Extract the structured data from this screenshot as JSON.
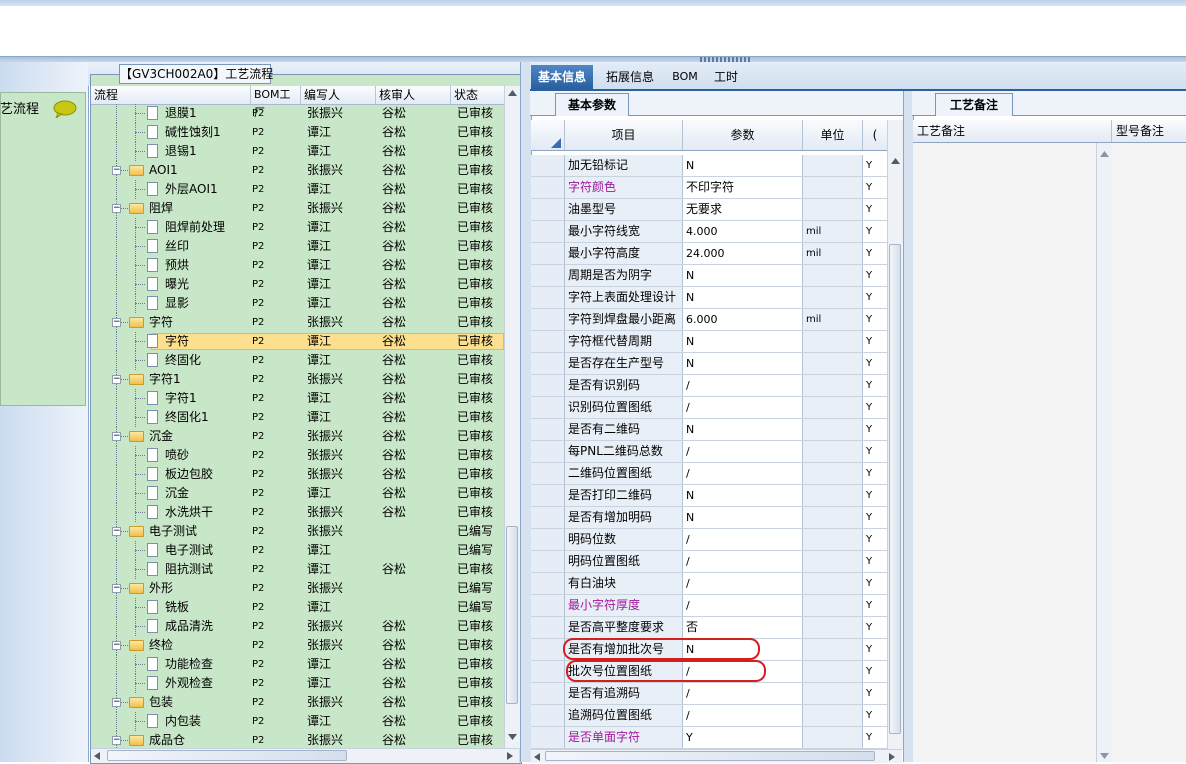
{
  "tree_panel": {
    "tab_title": "【GV3CH002A0】工艺流程",
    "left_label": "艺流程",
    "columns": [
      "流程",
      "BOM工厂",
      "编写人",
      "核审人",
      "状态"
    ],
    "rows": [
      {
        "level": 2,
        "type": "file",
        "name": "退膜1",
        "bom": "P2",
        "writer": "张振兴",
        "reviewer": "谷松",
        "status": "已审核"
      },
      {
        "level": 2,
        "type": "file",
        "name": "碱性蚀刻1",
        "bom": "P2",
        "writer": "谭江",
        "reviewer": "谷松",
        "status": "已审核"
      },
      {
        "level": 2,
        "type": "file",
        "name": "退锡1",
        "bom": "P2",
        "writer": "谭江",
        "reviewer": "谷松",
        "status": "已审核"
      },
      {
        "level": 1,
        "type": "folder",
        "name": "AOI1",
        "bom": "P2",
        "writer": "张振兴",
        "reviewer": "谷松",
        "status": "已审核"
      },
      {
        "level": 2,
        "type": "file",
        "name": "外层AOI1",
        "bom": "P2",
        "writer": "谭江",
        "reviewer": "谷松",
        "status": "已审核"
      },
      {
        "level": 1,
        "type": "folder",
        "name": "阻焊",
        "bom": "P2",
        "writer": "张振兴",
        "reviewer": "谷松",
        "status": "已审核"
      },
      {
        "level": 2,
        "type": "file",
        "name": "阻焊前处理",
        "bom": "P2",
        "writer": "谭江",
        "reviewer": "谷松",
        "status": "已审核"
      },
      {
        "level": 2,
        "type": "file",
        "name": "丝印",
        "bom": "P2",
        "writer": "谭江",
        "reviewer": "谷松",
        "status": "已审核"
      },
      {
        "level": 2,
        "type": "file",
        "name": "预烘",
        "bom": "P2",
        "writer": "谭江",
        "reviewer": "谷松",
        "status": "已审核"
      },
      {
        "level": 2,
        "type": "file",
        "name": "曝光",
        "bom": "P2",
        "writer": "谭江",
        "reviewer": "谷松",
        "status": "已审核"
      },
      {
        "level": 2,
        "type": "file",
        "name": "显影",
        "bom": "P2",
        "writer": "谭江",
        "reviewer": "谷松",
        "status": "已审核"
      },
      {
        "level": 1,
        "type": "folder",
        "name": "字符",
        "bom": "P2",
        "writer": "张振兴",
        "reviewer": "谷松",
        "status": "已审核"
      },
      {
        "level": 2,
        "type": "file",
        "name": "字符",
        "bom": "P2",
        "writer": "谭江",
        "reviewer": "谷松",
        "status": "已审核",
        "selected": true
      },
      {
        "level": 2,
        "type": "file",
        "name": "终固化",
        "bom": "P2",
        "writer": "谭江",
        "reviewer": "谷松",
        "status": "已审核"
      },
      {
        "level": 1,
        "type": "folder",
        "name": "字符1",
        "bom": "P2",
        "writer": "张振兴",
        "reviewer": "谷松",
        "status": "已审核"
      },
      {
        "level": 2,
        "type": "file",
        "name": "字符1",
        "bom": "P2",
        "writer": "谭江",
        "reviewer": "谷松",
        "status": "已审核"
      },
      {
        "level": 2,
        "type": "file",
        "name": "终固化1",
        "bom": "P2",
        "writer": "谭江",
        "reviewer": "谷松",
        "status": "已审核"
      },
      {
        "level": 1,
        "type": "folder",
        "name": "沉金",
        "bom": "P2",
        "writer": "张振兴",
        "reviewer": "谷松",
        "status": "已审核"
      },
      {
        "level": 2,
        "type": "file",
        "name": "喷砂",
        "bom": "P2",
        "writer": "张振兴",
        "reviewer": "谷松",
        "status": "已审核"
      },
      {
        "level": 2,
        "type": "file",
        "name": "板边包胶",
        "bom": "P2",
        "writer": "张振兴",
        "reviewer": "谷松",
        "status": "已审核"
      },
      {
        "level": 2,
        "type": "file",
        "name": "沉金",
        "bom": "P2",
        "writer": "谭江",
        "reviewer": "谷松",
        "status": "已审核"
      },
      {
        "level": 2,
        "type": "file",
        "name": "水洗烘干",
        "bom": "P2",
        "writer": "张振兴",
        "reviewer": "谷松",
        "status": "已审核"
      },
      {
        "level": 1,
        "type": "folder",
        "name": "电子测试",
        "bom": "P2",
        "writer": "张振兴",
        "reviewer": "",
        "status": "已编写"
      },
      {
        "level": 2,
        "type": "file",
        "name": "电子测试",
        "bom": "P2",
        "writer": "谭江",
        "reviewer": "",
        "status": "已编写"
      },
      {
        "level": 2,
        "type": "file",
        "name": "阻抗测试",
        "bom": "P2",
        "writer": "谭江",
        "reviewer": "谷松",
        "status": "已审核"
      },
      {
        "level": 1,
        "type": "folder",
        "name": "外形",
        "bom": "P2",
        "writer": "张振兴",
        "reviewer": "",
        "status": "已编写"
      },
      {
        "level": 2,
        "type": "file",
        "name": "铣板",
        "bom": "P2",
        "writer": "谭江",
        "reviewer": "",
        "status": "已编写"
      },
      {
        "level": 2,
        "type": "file",
        "name": "成品清洗",
        "bom": "P2",
        "writer": "张振兴",
        "reviewer": "谷松",
        "status": "已审核"
      },
      {
        "level": 1,
        "type": "folder",
        "name": "终检",
        "bom": "P2",
        "writer": "张振兴",
        "reviewer": "谷松",
        "status": "已审核"
      },
      {
        "level": 2,
        "type": "file",
        "name": "功能检查",
        "bom": "P2",
        "writer": "谭江",
        "reviewer": "谷松",
        "status": "已审核"
      },
      {
        "level": 2,
        "type": "file",
        "name": "外观检查",
        "bom": "P2",
        "writer": "谭江",
        "reviewer": "谷松",
        "status": "已审核"
      },
      {
        "level": 1,
        "type": "folder",
        "name": "包装",
        "bom": "P2",
        "writer": "张振兴",
        "reviewer": "谷松",
        "status": "已审核"
      },
      {
        "level": 2,
        "type": "file",
        "name": "内包装",
        "bom": "P2",
        "writer": "谭江",
        "reviewer": "谷松",
        "status": "已审核"
      },
      {
        "level": 1,
        "type": "folder",
        "name": "成品仓",
        "bom": "P2",
        "writer": "张振兴",
        "reviewer": "谷松",
        "status": "已审核"
      }
    ]
  },
  "main_tabs": [
    "基本信息",
    "拓展信息",
    "BOM",
    "工时"
  ],
  "params_panel": {
    "subtab": "基本参数",
    "columns": [
      "项目",
      "参数",
      "单位",
      "("
    ],
    "rows": [
      {
        "item": "加无铅标记",
        "value": "N",
        "unit": "",
        "flag": "Y"
      },
      {
        "item": "字符颜色",
        "value": "不印字符",
        "unit": "",
        "flag": "Y",
        "purple": true
      },
      {
        "item": "油墨型号",
        "value": "无要求",
        "unit": "",
        "flag": "Y"
      },
      {
        "item": "最小字符线宽",
        "value": "4.000",
        "unit": "mil",
        "flag": "Y"
      },
      {
        "item": "最小字符高度",
        "value": "24.000",
        "unit": "mil",
        "flag": "Y"
      },
      {
        "item": "周期是否为阴字",
        "value": "N",
        "unit": "",
        "flag": "Y"
      },
      {
        "item": "字符上表面处理设计",
        "value": "N",
        "unit": "",
        "flag": "Y"
      },
      {
        "item": "字符到焊盘最小距离",
        "value": "6.000",
        "unit": "mil",
        "flag": "Y"
      },
      {
        "item": "字符框代替周期",
        "value": "N",
        "unit": "",
        "flag": "Y"
      },
      {
        "item": "是否存在生产型号",
        "value": "N",
        "unit": "",
        "flag": "Y"
      },
      {
        "item": "是否有识别码",
        "value": "/",
        "unit": "",
        "flag": "Y"
      },
      {
        "item": "识别码位置图纸",
        "value": "/",
        "unit": "",
        "flag": "Y"
      },
      {
        "item": "是否有二维码",
        "value": "N",
        "unit": "",
        "flag": "Y"
      },
      {
        "item": "每PNL二维码总数",
        "value": "/",
        "unit": "",
        "flag": "Y"
      },
      {
        "item": "二维码位置图纸",
        "value": "/",
        "unit": "",
        "flag": "Y"
      },
      {
        "item": "是否打印二维码",
        "value": "N",
        "unit": "",
        "flag": "Y"
      },
      {
        "item": "是否有增加明码",
        "value": "N",
        "unit": "",
        "flag": "Y"
      },
      {
        "item": "明码位数",
        "value": "/",
        "unit": "",
        "flag": "Y"
      },
      {
        "item": "明码位置图纸",
        "value": "/",
        "unit": "",
        "flag": "Y"
      },
      {
        "item": "有白油块",
        "value": "/",
        "unit": "",
        "flag": "Y"
      },
      {
        "item": "最小字符厚度",
        "value": "/",
        "unit": "",
        "flag": "Y",
        "purple": true
      },
      {
        "item": "是否高平整度要求",
        "value": "否",
        "unit": "",
        "flag": "Y"
      },
      {
        "item": "是否有增加批次号",
        "value": "N",
        "unit": "",
        "flag": "Y",
        "circled": true
      },
      {
        "item": "批次号位置图纸",
        "value": "/",
        "unit": "",
        "flag": "Y",
        "circled": true
      },
      {
        "item": "是否有追溯码",
        "value": "/",
        "unit": "",
        "flag": "Y"
      },
      {
        "item": "追溯码位置图纸",
        "value": "/",
        "unit": "",
        "flag": "Y"
      },
      {
        "item": "是否单面字符",
        "value": "Y",
        "unit": "",
        "flag": "Y",
        "purple": true
      }
    ]
  },
  "notes_panel": {
    "tab": "工艺备注",
    "columns": [
      "工艺备注",
      "型号备注"
    ]
  },
  "colors": {
    "tree_bg": "#c8e7c8",
    "selection": "#fde08f",
    "active_tab": "#2a5f9f",
    "purple_text": "#a0189c",
    "annotation_red": "#d41f1f"
  }
}
